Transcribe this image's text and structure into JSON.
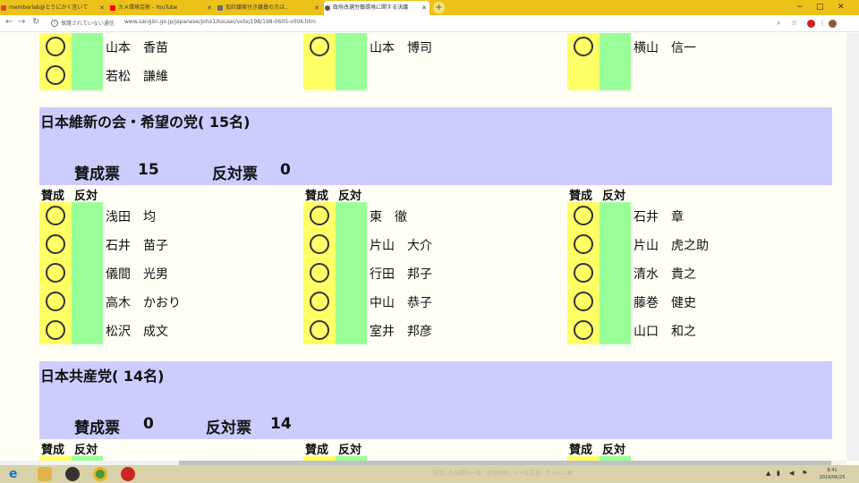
{
  "browser": {
    "tabs": [
      {
        "label": "memberlab@とりにかく言いて",
        "fav_color": "#e34234"
      },
      {
        "label": "カメ環境芸術 - YouTube",
        "fav_color": "#ff0000"
      },
      {
        "label": "加計議案付き議員の方は..",
        "fav_color": "#6b6b6b"
      },
      {
        "label": "政府改選労働環境に関する決議",
        "fav_color": "#555555"
      }
    ],
    "new_tab": "+",
    "security_text": "保護されていない通信",
    "url": "www.sangiin.go.jp/japanese/joho1/kousei/vote/198/198-0605-v006.htm",
    "icon_minimize": "−",
    "icon_maximize": "□",
    "icon_close": "✕"
  },
  "sections": {
    "top": {
      "columns": [
        [
          "山本　香苗",
          "若松　謙維"
        ],
        [
          "山本　博司"
        ],
        [
          "横山　信一"
        ]
      ]
    },
    "ishin": {
      "title": "日本維新の会・希望の党( 15名)",
      "yes_label": "賛成票",
      "yes_count": "15",
      "no_label": "反対票",
      "no_count": "0",
      "col_yes": "賛成",
      "col_no": "反対",
      "columns": [
        [
          "浅田　均",
          "石井　苗子",
          "儀間　光男",
          "高木　かおり",
          "松沢　成文"
        ],
        [
          "東　徹",
          "片山　大介",
          "行田　邦子",
          "中山　恭子",
          "室井　邦彦"
        ],
        [
          "石井　章",
          "片山　虎之助",
          "清水　貴之",
          "藤巻　健史",
          "山口　和之"
        ]
      ]
    },
    "jcp": {
      "title": "日本共産党( 14名)",
      "yes_label": "賛成票",
      "yes_count": "0",
      "no_label": "反対票",
      "no_count": "14",
      "col_yes": "賛成",
      "col_no": "反対"
    }
  },
  "taskbar": {
    "ghost_text": "送信した記録の一覧　送信予約　メール送信　アドレス帳",
    "time": "8:41",
    "date": "2019/06/25"
  },
  "colors": {
    "yes_cell": "#ffff66",
    "no_cell": "#99ff99",
    "party_header": "#ccccff",
    "tab_bar": "#ecc21a"
  }
}
